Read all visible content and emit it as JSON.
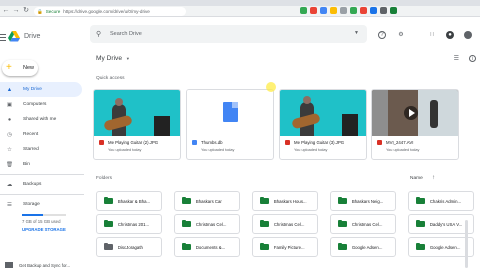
{
  "browser": {
    "secure_label": "Secure",
    "url": "https://drive.google.com/drive/u/0/my-drive"
  },
  "app": {
    "title": "Drive",
    "search_placeholder": "Search Drive"
  },
  "sidebar": {
    "new_label": "New",
    "items": [
      {
        "label": "My Drive",
        "icon": "drive-icon",
        "active": true
      },
      {
        "label": "Computers",
        "icon": "computer-icon"
      },
      {
        "label": "Shared with me",
        "icon": "people-icon"
      },
      {
        "label": "Recent",
        "icon": "clock-icon"
      },
      {
        "label": "Starred",
        "icon": "star-icon"
      },
      {
        "label": "Bin",
        "icon": "trash-icon"
      }
    ],
    "backups_label": "Backups",
    "storage_label": "Storage",
    "storage_used": "7 GB of 15 GB used",
    "storage_fraction": 0.47,
    "upgrade_label": "UPGRADE STORAGE",
    "backup_tip": "Get Backup and Sync for..."
  },
  "main": {
    "title": "My Drive",
    "quick_access_label": "Quick access",
    "quick_access": [
      {
        "name": "Me Playing Guitar (2).JPG",
        "sub": "You uploaded today",
        "file_color": "#d93025"
      },
      {
        "name": "Thumbs.db",
        "sub": "You uploaded today",
        "file_color": "#4285f4"
      },
      {
        "name": "Me Playing Guitar (3).JPG",
        "sub": "You uploaded today",
        "file_color": "#d93025"
      },
      {
        "name": "MVI_2447.AVI",
        "sub": "You uploaded today",
        "file_color": "#d93025"
      }
    ],
    "folders_label": "Folders",
    "sort_label": "Name",
    "folders": [
      {
        "name": "Bhaskar & Bha..."
      },
      {
        "name": "Bhaskars Car"
      },
      {
        "name": "Bhaskars Hous..."
      },
      {
        "name": "Bhaskars Neig..."
      },
      {
        "name": "Chakris Admin..."
      },
      {
        "name": "Christmas 201..."
      },
      {
        "name": "Christmas Cel..."
      },
      {
        "name": "Christmas Cel..."
      },
      {
        "name": "Christmas Cel..."
      },
      {
        "name": "Daddy's USA V..."
      },
      {
        "name": "DiscJoragath",
        "grey": true
      },
      {
        "name": "Documents &..."
      },
      {
        "name": "Family Picture..."
      },
      {
        "name": "Google Adsen..."
      },
      {
        "name": "Google Adsen..."
      }
    ]
  }
}
